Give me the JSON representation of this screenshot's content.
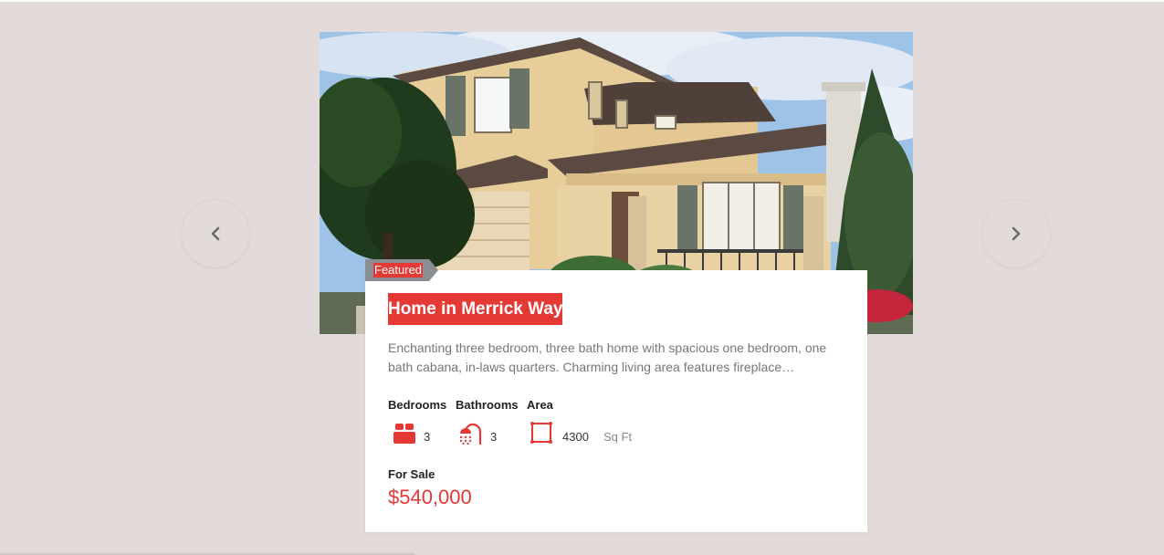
{
  "listing": {
    "badge": "Featured",
    "title": "Home in Merrick Way",
    "description": "Enchanting three bedroom, three bath home with spacious one bedroom, one bath cabana, in-laws quarters. Charming living area features fireplace…",
    "features": {
      "bedrooms_label": "Bedrooms",
      "bathrooms_label": "Bathrooms",
      "area_label": "Area",
      "bedrooms_value": "3",
      "bathrooms_value": "3",
      "area_value": "4300",
      "area_unit": "Sq Ft"
    },
    "status": "For Sale",
    "price": "$540,000"
  },
  "icons": {
    "prev": "chevron-left-icon",
    "next": "chevron-right-icon",
    "bed": "bed-icon",
    "shower": "shower-icon",
    "area": "area-icon"
  },
  "colors": {
    "accent": "#e53935",
    "background": "#e3dbd9",
    "card": "#ffffff"
  }
}
